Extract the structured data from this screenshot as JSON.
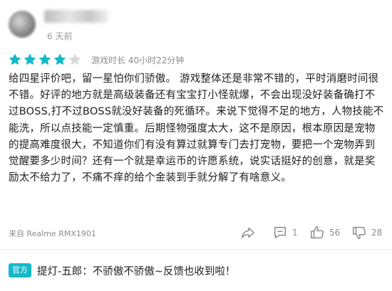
{
  "author": {
    "time_ago": "6 天前"
  },
  "rating": {
    "stars_filled": 4,
    "stars_total": 5,
    "star_color": "#14b9c8",
    "star_empty_color": "#d9d9d9",
    "playtime": "游戏时长 40小时22分钟"
  },
  "review": {
    "text": "给四星评价吧，留一星怕你们骄傲。 游戏整体还是非常不错的，平时消磨时间很不错。好评的地方就是高级装备还有宝宝打小怪就爆，不会出现没好装备确打不过BOSS,打不过BOSS就没好装备的死循环。来说下觉得不足的地方，人物技能不能洗，所以点技能一定慎重。后期怪物强度太大，这不是原因，根本原因是宠物的提高难度很大，不知道你们有没有算过就算专门去打宠物，要把一个宠物弄到觉醒要多少时间？还有一个就是幸运币的许愿系统，说实话挺好的创意，就是奖励太不给力了，不痛不痒的给个金装到手就分解了有啥意义。"
  },
  "footer": {
    "device": "来自 Realme RMX1901",
    "comment_count": "1",
    "like_count": "56",
    "dislike_count": "28"
  },
  "official_reply": {
    "badge": "官方",
    "text": "提灯-五郎：不骄傲不骄傲~反馈也收到啦！"
  }
}
